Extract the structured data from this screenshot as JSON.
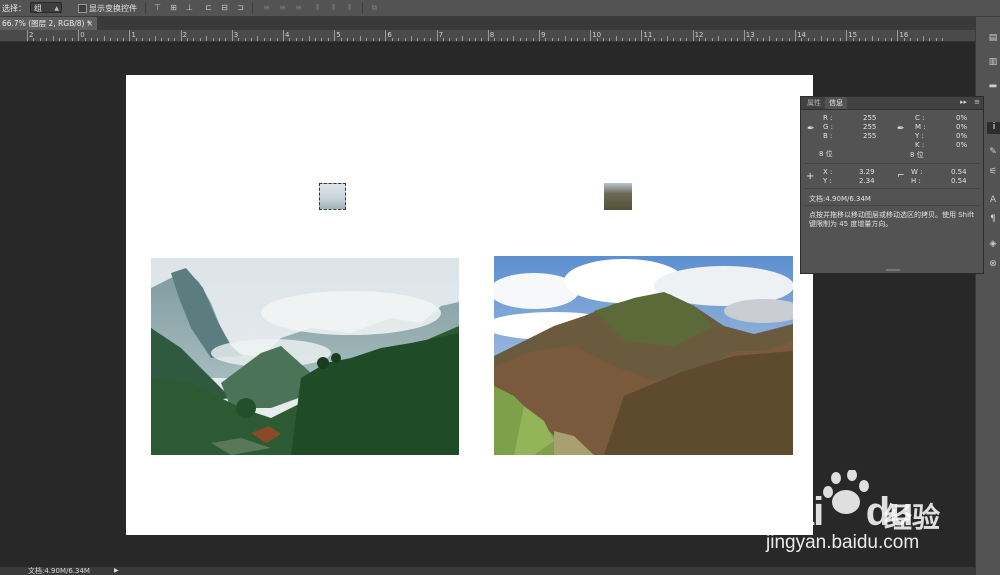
{
  "options_bar": {
    "auto_select_label": "选择：",
    "auto_select_value": "组",
    "show_transform_label": "显示变换控件"
  },
  "document_tab": {
    "title": "66.7% (图层 2, RGB/8) *",
    "close": "×"
  },
  "ruler": {
    "labels": [
      "2",
      "0",
      "1",
      "2",
      "3",
      "4",
      "5",
      "6",
      "7",
      "8",
      "9",
      "10",
      "11",
      "12",
      "13",
      "14",
      "15",
      "16"
    ]
  },
  "info_panel": {
    "tabs": [
      "属性",
      "信息"
    ],
    "active_tab": "信息",
    "rgb": {
      "r_label": "R :",
      "r": "255",
      "g_label": "G :",
      "g": "255",
      "b_label": "B :",
      "b": "255"
    },
    "cmyk": {
      "c_label": "C :",
      "c": "0%",
      "m_label": "M :",
      "m": "0%",
      "y_label": "Y :",
      "y": "0%",
      "k_label": "K :",
      "k": "0%"
    },
    "bit_depth_left": "8 位",
    "bit_depth_right": "8 位",
    "position": {
      "x_label": "X :",
      "x": "3.29",
      "y_label": "Y :",
      "y": "2.34"
    },
    "size": {
      "w_label": "W :",
      "w": "0.54",
      "h_label": "H :",
      "h": "0.54"
    },
    "doc_size": "文档:4.90M/6.34M",
    "hint": "点按并拖移以移动图层或移动选区的拷贝。使用 Shift 键限制为 45 度增量方向。"
  },
  "status_bar": {
    "doc_size": "文档:4.90M/6.34M",
    "arrow": "▶"
  },
  "watermark": {
    "brand": "Bai",
    "brand2": "du",
    "cn": "经验",
    "url": "jingyan.baidu.com"
  },
  "colors": {
    "workspace": "#282828",
    "panel": "#535353",
    "document": "#ffffff"
  }
}
